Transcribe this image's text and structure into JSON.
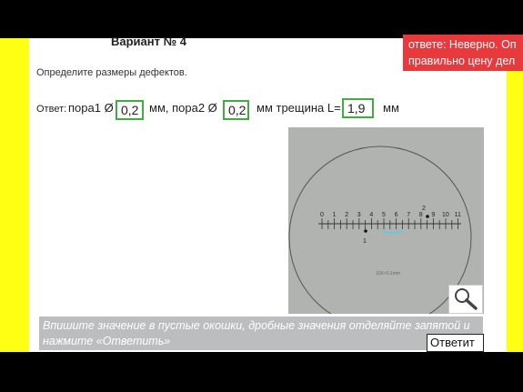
{
  "page": {
    "title": "Вариант № 4",
    "task": "Определите размеры дефектов."
  },
  "answer": {
    "lead": "Ответ:",
    "pore1_label": "пора1 Ø",
    "pore1_value": "0,2",
    "unit1": "мм, пора2 Ø",
    "pore2_value": "0,2",
    "unit2": "мм трещина L=",
    "crack_value": "1,9",
    "unit3": "мм"
  },
  "feedback": {
    "line1": "ответе: Неверно. Оп",
    "line2": "правильно цену дел"
  },
  "photo": {
    "scale_ticks": [
      "0",
      "1",
      "2",
      "3",
      "4",
      "5",
      "6",
      "7",
      "8",
      "9",
      "10",
      "11"
    ],
    "defect1_label": "1",
    "defect2_label": "2",
    "magnification": "10X×0.1mm"
  },
  "hint": "Впишите значение в пустые окошки, дробные значения отделяйте запятой и нажмите «Ответить»",
  "submit_label": "Ответит",
  "colors": {
    "accent_yellow": "#ffff14",
    "input_border": "#3fae3f",
    "feedback_bg": "#e8393c",
    "hint_bg": "#bbbdbf"
  }
}
